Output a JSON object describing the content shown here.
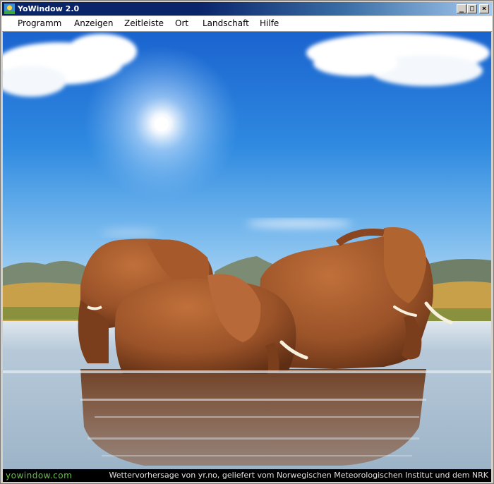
{
  "window": {
    "title": "YoWindow 2.0",
    "controls": {
      "minimize": "_",
      "maximize": "□",
      "close": "×"
    }
  },
  "menu": {
    "items": [
      "Programm",
      "Anzeigen",
      "Zeitleiste",
      "Ort",
      "Landschaft",
      "Hilfe"
    ]
  },
  "scene": {
    "name": "elephant-landscape",
    "sky_top": "#1e6fd6",
    "sky_horizon": "#a8d0f0",
    "water": "#b8c8d8"
  },
  "status": {
    "site": "yowindow.com",
    "credit": "Wettervorhersage von yr.no, geliefert vom Norwegischen Meteorologischen Institut und dem NRK"
  }
}
